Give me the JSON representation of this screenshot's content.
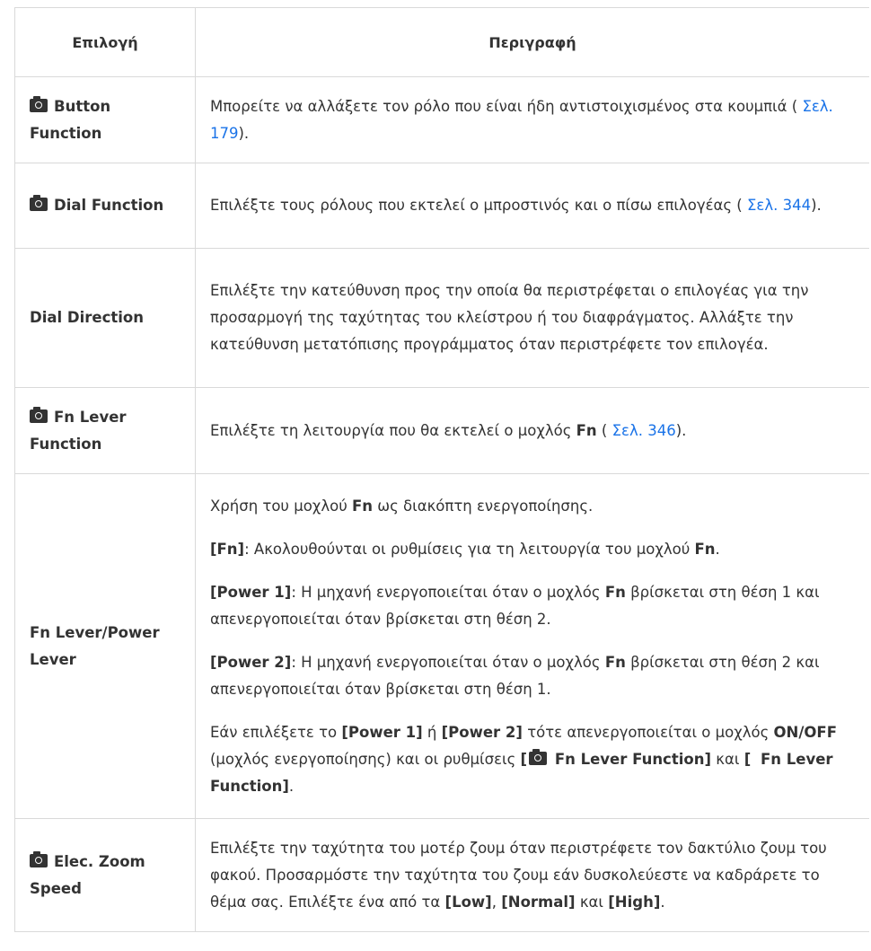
{
  "header": {
    "col_option": "Επιλογή",
    "col_description": "Περιγραφή"
  },
  "rows": [
    {
      "name": "Button Function",
      "desc_a": "Μπορείτε να αλλάξετε τον ρόλο που είναι ήδη αντιστοιχισμένος στα κουμπιά (",
      "ref": " Σελ. 179",
      "desc_b": ")."
    },
    {
      "name": "Dial Function",
      "desc_a": "Επιλέξτε τους ρόλους που εκτελεί ο μπροστινός και ο πίσω επιλογέας (",
      "ref": " Σελ. 344",
      "desc_b": ")."
    },
    {
      "name": "Dial Direction",
      "desc": "Επιλέξτε την κατεύθυνση προς την οποία θα περιστρέφεται ο επιλογέας για την προσαρμογή της ταχύτητας του κλείστρου ή του διαφράγματος. Αλλάξτε την κατεύθυνση μετατόπισης προγράμματος όταν περιστρέφετε τον επιλογέα."
    },
    {
      "name": "Fn Lever Function",
      "desc_a": "Επιλέξτε τη λειτουργία που θα εκτελεί ο μοχλός ",
      "bold": "Fn",
      "desc_b": " (",
      "ref": " Σελ. 346",
      "desc_c": ")."
    },
    {
      "name": "Fn Lever/Power Lever",
      "p1_a": "Χρήση του μοχλού ",
      "p1_bold": "Fn",
      "p1_b": " ως διακόπτη ενεργοποίησης.",
      "p2_bold": "[Fn]",
      "p2_a": ": Ακολουθούνται οι ρυθμίσεις για τη λειτουργία του μοχλού ",
      "p2_bold2": "Fn",
      "p2_b": ".",
      "p3_bold": "[Power 1]",
      "p3_a": ": Η μηχανή ενεργοποιείται όταν ο μοχλός ",
      "p3_bold2": "Fn",
      "p3_b": " βρίσκεται στη θέση 1 και απενεργοποιείται όταν βρίσκεται στη θέση 2.",
      "p4_bold": "[Power 2]",
      "p4_a": ": Η μηχανή ενεργοποιείται όταν ο μοχλός ",
      "p4_bold2": "Fn",
      "p4_b": " βρίσκεται στη θέση 2 και απενεργοποιείται όταν βρίσκεται στη θέση 1.",
      "p5_a": "Εάν επιλέξετε το ",
      "p5_bold1": "[Power 1]",
      "p5_b": " ή ",
      "p5_bold2": "[Power 2]",
      "p5_c": " τότε απενεργοποιείται ο μοχλός ",
      "p5_bold3": "ON/OFF",
      "p5_d": " (μοχλός ενεργοποίησης) και οι ρυθμίσεις ",
      "p5_bold4_open": "[",
      "p5_bold4_text": " Fn Lever Function]",
      "p5_e": " και ",
      "p5_bold5_open": "[",
      "p5_movie_glyph": "",
      "p5_bold5_text": " Fn Lever Function]",
      "p5_f": "."
    },
    {
      "name": "Elec. Zoom Speed",
      "desc_a": "Επιλέξτε την ταχύτητα του μοτέρ ζουμ όταν περιστρέφετε τον δακτύλιο ζουμ του φακού. Προσαρμόστε την ταχύτητα του ζουμ εάν δυσκολεύεστε να καδράρετε το θέμα σας. Επιλέξτε ένα από τα ",
      "b1": "[Low]",
      "sep1": ", ",
      "b2": "[Normal]",
      "sep2": " και ",
      "b3": "[High]",
      "end": "."
    }
  ],
  "colors": {
    "link": "#1a73e8",
    "text": "#333333",
    "border": "#d9d9d9"
  },
  "icons": {
    "camera": "camera-icon",
    "movie": "movie-icon"
  }
}
